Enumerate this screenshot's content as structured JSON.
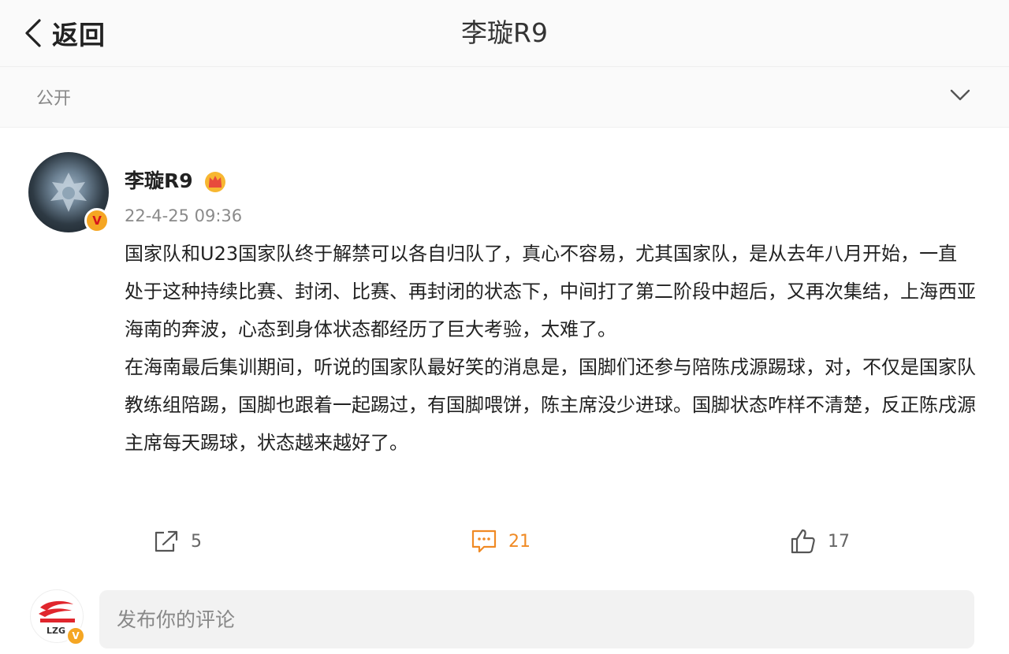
{
  "header": {
    "back_label": "返回",
    "title": "李璇R9"
  },
  "visibility": {
    "label": "公开"
  },
  "post": {
    "author": "李璇R9",
    "timestamp": "22-4-25 09:36",
    "paragraphs": [
      "国家队和U23国家队终于解禁可以各自归队了，真心不容易，尤其国家队，是从去年八月开始，一直处于这种持续比赛、封闭、比赛、再封闭的状态下，中间打了第二阶段中超后，又再次集结，上海西亚海南的奔波，心态到身体状态都经历了巨大考验，太难了。",
      "在海南最后集训期间，听说的国家队最好笑的消息是，国脚们还参与陪陈戌源踢球，对，不仅是国家队教练组陪踢，国脚也跟着一起踢过，有国脚喂饼，陈主席没少进球。国脚状态咋样不清楚，反正陈戌源主席每天踢球，状态越来越好了。"
    ]
  },
  "actions": {
    "share_count": "5",
    "comment_count": "21",
    "like_count": "17"
  },
  "comment_bar": {
    "placeholder": "发布你的评论",
    "avatar_text": "LZG"
  },
  "colors": {
    "comment_accent": "#f08a24",
    "verified_badge": "#f5a623",
    "muted_text": "#888888"
  },
  "icons": {
    "back": "chevron-left-icon",
    "visibility_toggle": "chevron-down-icon",
    "crown": "crown-icon",
    "share": "share-icon",
    "comment": "comment-icon",
    "like": "thumbs-up-icon"
  }
}
